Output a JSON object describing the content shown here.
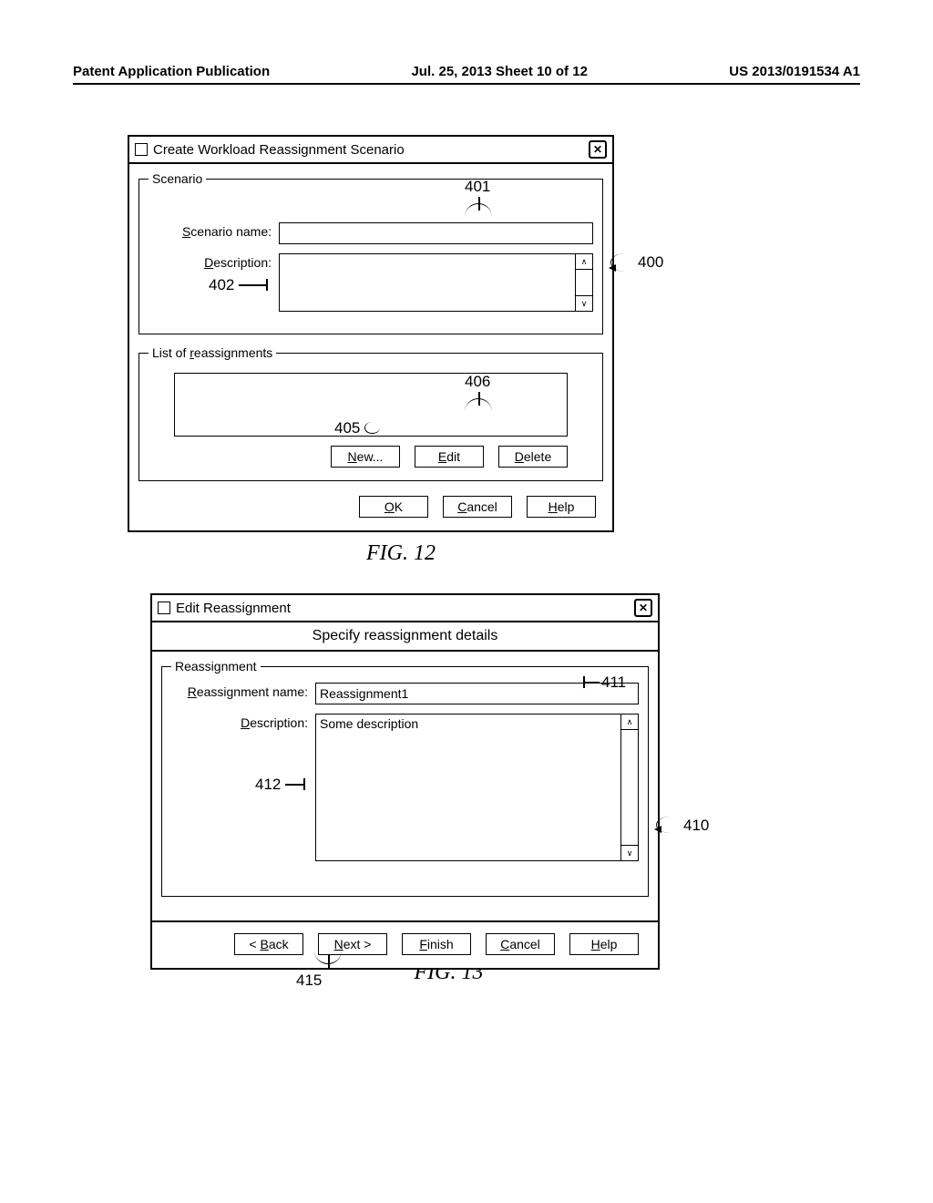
{
  "header": {
    "left": "Patent Application Publication",
    "center": "Jul. 25, 2013  Sheet 10 of 12",
    "right": "US 2013/0191534 A1"
  },
  "fig12": {
    "title": "Create Workload Reassignment Scenario",
    "groupbox_scenario": "Scenario",
    "scenario_name_label": "Scenario name:",
    "scenario_name_value": "",
    "description_label": "Description:",
    "description_value": "",
    "groupbox_list": "List of reassignments",
    "btn_new": "New...",
    "btn_edit": "Edit",
    "btn_delete": "Delete",
    "btn_ok": "OK",
    "btn_cancel": "Cancel",
    "btn_help": "Help",
    "caption": "FIG. 12",
    "callouts": {
      "c400": "400",
      "c401": "401",
      "c402": "402",
      "c405": "405",
      "c406": "406"
    }
  },
  "fig13": {
    "title": "Edit Reassignment",
    "subtitle": "Specify reassignment details",
    "groupbox_reassignment": "Reassignment",
    "reassignment_name_label": "Reassignment name:",
    "reassignment_name_value": "Reassignment1",
    "description_label": "Description:",
    "description_value": "Some description",
    "btn_back": "< Back",
    "btn_next": "Next >",
    "btn_finish": "Finish",
    "btn_cancel": "Cancel",
    "btn_help": "Help",
    "caption": "FIG. 13",
    "callouts": {
      "c410": "410",
      "c411": "411",
      "c412": "412",
      "c415": "415"
    }
  }
}
